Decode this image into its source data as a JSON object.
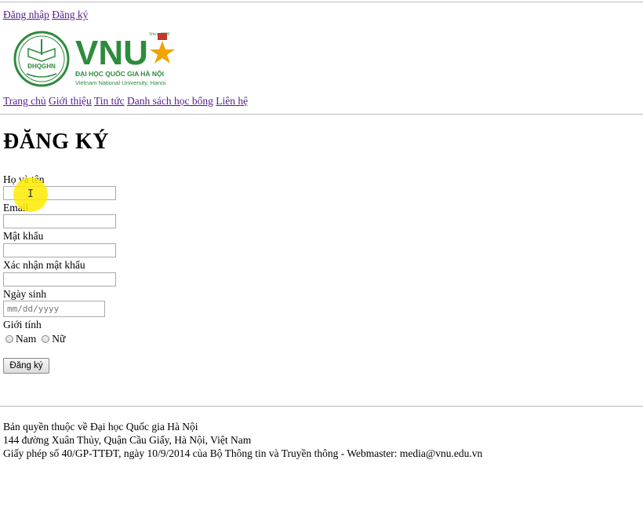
{
  "top_links": {
    "login": "Đăng nhập",
    "register": "Đăng ký"
  },
  "logo": {
    "abbr": "ĐHQGHN",
    "wordmark": "VNU",
    "since": "Since 1906",
    "name_vi": "ĐẠI HỌC QUỐC GIA HÀ NỘI",
    "name_en": "Vietnam National University, Hanoi",
    "brand_color": "#2e8b3e",
    "star_color": "#f0a500"
  },
  "nav": {
    "items": [
      "Trang chủ",
      "Giới thiệu",
      "Tin tức",
      "Danh sách học bổng",
      "Liên hệ"
    ]
  },
  "page_title": "ĐĂNG KÝ",
  "form": {
    "full_name_label": "Họ và tên",
    "email_label": "Email",
    "password_label": "Mật khẩu",
    "confirm_password_label": "Xác nhận mật khẩu",
    "birthday_label": "Ngày sinh",
    "birthday_placeholder": "mm/dd/yyyy",
    "gender_label": "Giới tính",
    "gender_options": [
      "Nam",
      "Nữ"
    ],
    "submit_label": "Đăng ký"
  },
  "footer": {
    "line1": "Bản quyền thuộc về Đại học Quốc gia Hà Nội",
    "line2": "144 đường Xuân Thủy, Quận Cầu Giấy, Hà Nội, Việt Nam",
    "line3": "Giấy phép số 40/GP-TTĐT, ngày 10/9/2014 của Bộ Thông tin và Truyền thông - Webmaster: media@vnu.edu.vn"
  }
}
